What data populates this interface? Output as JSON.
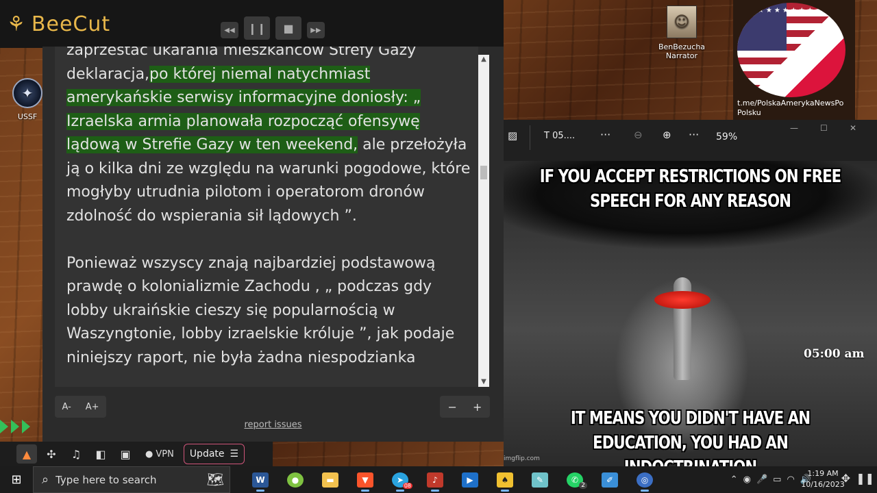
{
  "beecut": {
    "logo_text": "BeeCut"
  },
  "reader": {
    "paragraphs": [
      {
        "segments": [
          {
            "text": "zaprzestać ukarania mieszkańców Strefy Gazy ",
            "hl": false
          },
          {
            "text": "deklaracja,",
            "hl": false
          },
          {
            "text": "po której niemal natychmiast amerykańskie serwisy informacyjne doniosły: „ Izraelska armia planowała rozpocząć ofensywę lądową w Strefie Gazy w ten weekend,",
            "hl": true
          },
          {
            "text": " ale przełożyła ją o kilka dni ze względu na warunki pogodowe, które mogłyby utrudnia pilotom i operatorom dronów zdolność do wspierania sił lądowych ”.",
            "hl": false
          }
        ]
      },
      {
        "segments": [
          {
            "text": "Ponieważ wszyscy znają najbardziej podstawową prawdę o kolonializmie Zachodu , „ podczas gdy lobby ukraińskie cieszy się popularnością w Waszyngtonie, lobby izraelskie króluje ”, jak podaje niniejszy raport, nie była żadna niespodzianka",
            "hl": false
          }
        ]
      }
    ],
    "font_decrease": "A-",
    "font_increase": "A+",
    "zoom_minus": "−",
    "zoom_plus": "+",
    "report_link": "report issues"
  },
  "desktop": {
    "ussf_label": "USSF",
    "narrator_label": "BenBezucha Narrator",
    "flag_caption": "t.me/PolskaAmerykaNewsPo Polsku"
  },
  "photos": {
    "file_name": "T 05....",
    "zoom_level": "59%",
    "meme_top": "IF YOU ACCEPT RESTRICTIONS ON FREE SPEECH FOR ANY REASON",
    "meme_bottom": "IT MEANS YOU DIDN'T HAVE AN EDUCATION, YOU HAD AN INDOCTRINATION",
    "watermark": "imgflip.com"
  },
  "overlay_time": "05:00 am",
  "browser_bar": {
    "vpn_label": "VPN",
    "update_label": "Update"
  },
  "taskbar": {
    "search_placeholder": "Type here to search",
    "time": "1:19 AM",
    "date": "10/16/2023",
    "telegram_badge": "08",
    "whatsapp_badge": "2"
  },
  "colors": {
    "highlight": "#1e5e16",
    "beecut_gold": "#e8b74a",
    "update_border": "#d0557a"
  }
}
